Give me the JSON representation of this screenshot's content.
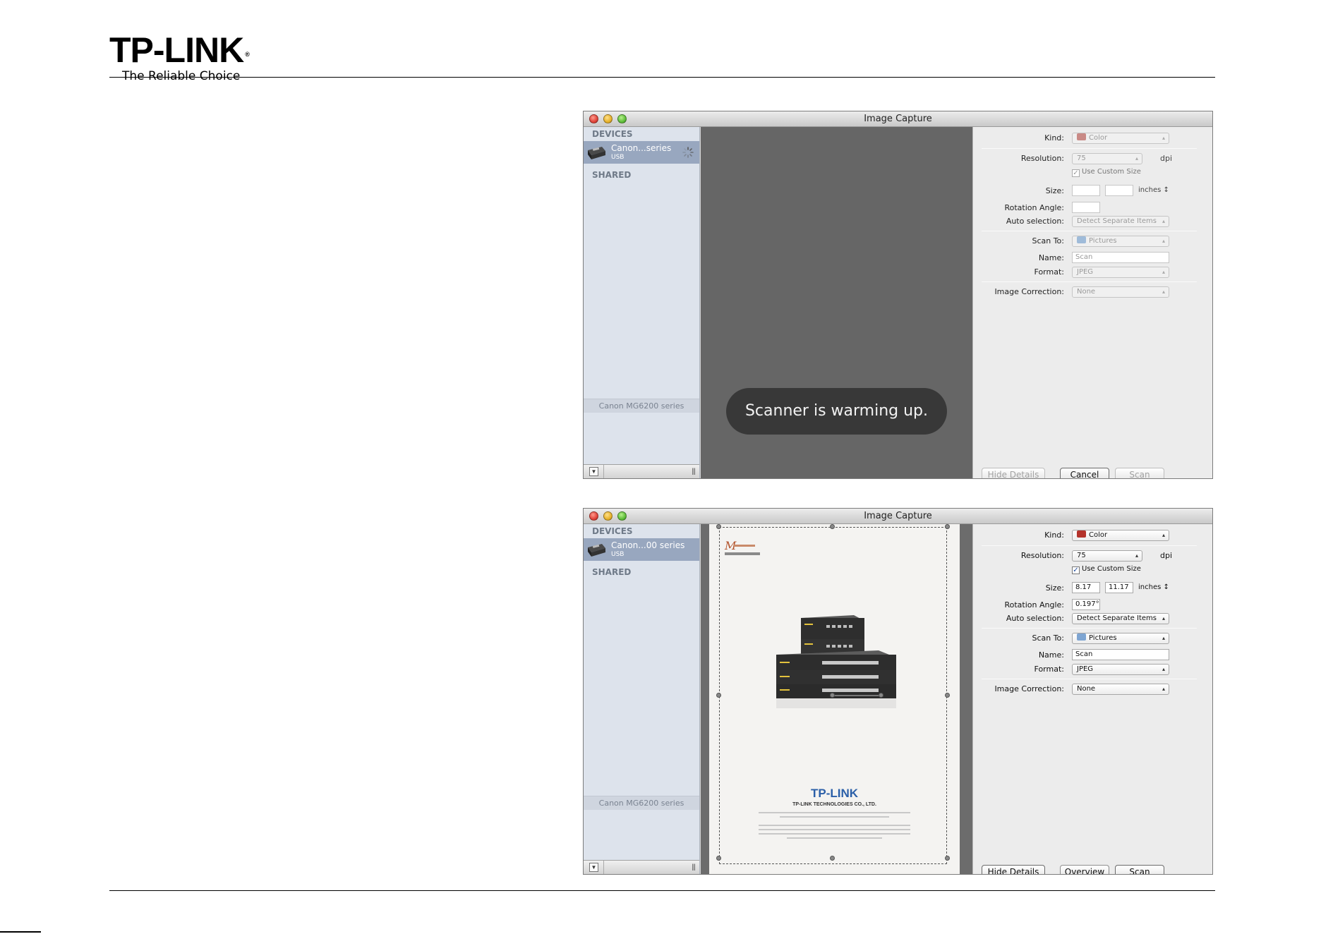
{
  "header": {
    "logo_text": "TP-LINK",
    "logo_mark": "®",
    "tagline": "The Reliable Choice"
  },
  "windows": [
    {
      "title": "Image Capture",
      "sidebar": {
        "devices_header": "DEVICES",
        "device_name": "Canon...series",
        "device_sub": "USB",
        "shared_header": "SHARED",
        "footer_label": "Canon MG6200 series"
      },
      "toast": "Scanner is warming up.",
      "settings": {
        "kind_label": "Kind:",
        "kind_value": "Color",
        "resolution_label": "Resolution:",
        "resolution_value": "75",
        "resolution_unit": "dpi",
        "custom_size_label": "Use Custom Size",
        "size_label": "Size:",
        "size_w": "",
        "size_h": "",
        "size_unit": "inches",
        "rotation_label": "Rotation Angle:",
        "rotation_value": "",
        "auto_label": "Auto selection:",
        "auto_value": "Detect Separate Items",
        "scanto_label": "Scan To:",
        "scanto_value": "Pictures",
        "name_label": "Name:",
        "name_value": "Scan",
        "format_label": "Format:",
        "format_value": "JPEG",
        "correction_label": "Image Correction:",
        "correction_value": "None"
      },
      "buttons": {
        "details": "Hide Details",
        "middle": "Cancel",
        "scan": "Scan"
      }
    },
    {
      "title": "Image Capture",
      "sidebar": {
        "devices_header": "DEVICES",
        "device_name": "Canon...00 series",
        "device_sub": "USB",
        "shared_header": "SHARED",
        "footer_label": "Canon MG6200 series"
      },
      "preview": {
        "brand": "TP-LINK",
        "company": "TP-LINK TECHNOLOGIES CO., LTD."
      },
      "settings": {
        "kind_label": "Kind:",
        "kind_value": "Color",
        "resolution_label": "Resolution:",
        "resolution_value": "75",
        "resolution_unit": "dpi",
        "custom_size_label": "Use Custom Size",
        "size_label": "Size:",
        "size_w": "8.17",
        "size_h": "11.17",
        "size_unit": "inches",
        "rotation_label": "Rotation Angle:",
        "rotation_value": "0.197°",
        "auto_label": "Auto selection:",
        "auto_value": "Detect Separate Items",
        "scanto_label": "Scan To:",
        "scanto_value": "Pictures",
        "name_label": "Name:",
        "name_value": "Scan",
        "format_label": "Format:",
        "format_value": "JPEG",
        "correction_label": "Image Correction:",
        "correction_value": "None"
      },
      "buttons": {
        "details": "Hide Details",
        "middle": "Overview",
        "scan": "Scan"
      }
    }
  ]
}
